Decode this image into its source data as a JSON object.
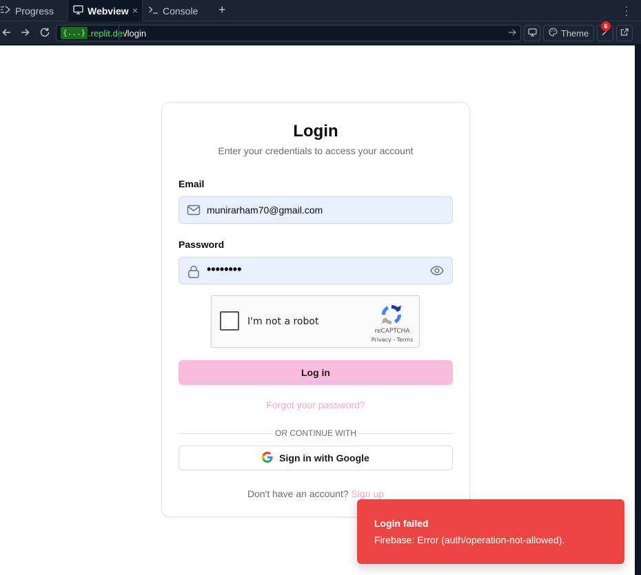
{
  "ide": {
    "tabs": [
      {
        "label": "Progress",
        "icon": "progress-icon",
        "active": false
      },
      {
        "label": "Webview",
        "icon": "monitor-icon",
        "active": true
      },
      {
        "label": "Console",
        "icon": "terminal-icon",
        "active": false
      }
    ],
    "add_tab": "+",
    "close_glyph": "×",
    "url": {
      "brace": "{...}",
      "host": ".replit.dev",
      "path": "/login"
    },
    "toolbar": {
      "theme_label": "Theme",
      "devtools_badge": "6"
    }
  },
  "login_card": {
    "title": "Login",
    "subtitle": "Enter your credentials to access your account",
    "email_label": "Email",
    "email_value": "munirarham70@gmail.com",
    "password_label": "Password",
    "password_masked": "••••••••",
    "captcha": {
      "text": "I'm not a robot",
      "brand": "reCAPTCHA",
      "links": "Privacy - Terms"
    },
    "login_button": "Log in",
    "forgot_link": "Forgot your password?",
    "divider_text": "OR CONTINUE WITH",
    "google_button": "Sign in with Google",
    "signup_prompt": "Don't have an account?",
    "signup_link": "Sign up"
  },
  "toast": {
    "title": "Login failed",
    "message": "Firebase: Error (auth/operation-not-allowed)."
  },
  "colors": {
    "accent_pink": "#fbbbdc",
    "link_pink": "#f7a6cf",
    "toast_red": "#ef4444",
    "field_bg": "#e8effd",
    "ide_bg": "#1c2333"
  }
}
